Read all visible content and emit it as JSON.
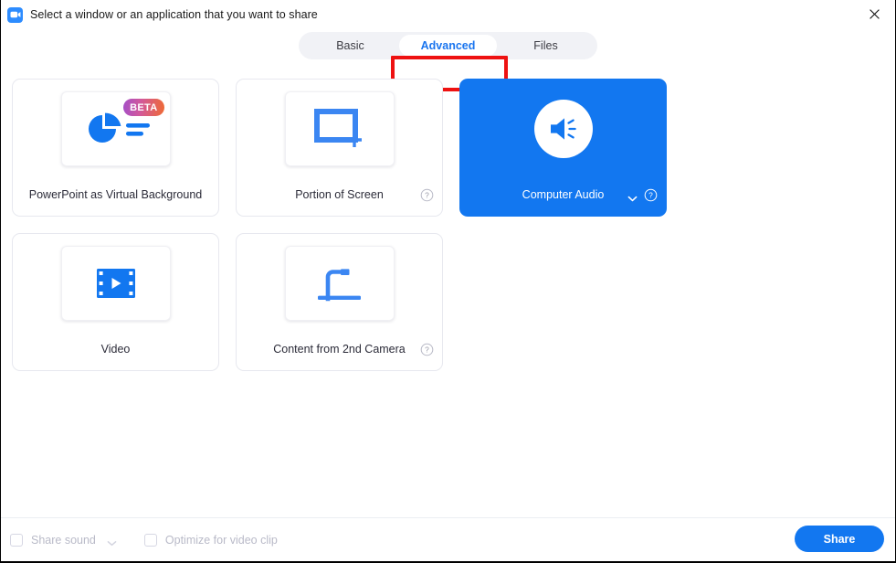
{
  "window": {
    "title": "Select a window or an application that you want to share",
    "app_icon": "zoom-video-icon",
    "close_icon": "close-icon"
  },
  "tabs": {
    "items": [
      {
        "label": "Basic",
        "active": false
      },
      {
        "label": "Advanced",
        "active": true
      },
      {
        "label": "Files",
        "active": false
      }
    ],
    "annotation_color": "#ee1111",
    "active_text_color": "#1a75ef"
  },
  "cards": [
    {
      "label": "PowerPoint as Virtual Background",
      "icon": "pie-chart-slide-icon",
      "badge": "BETA",
      "selected": false,
      "has_help": false,
      "has_chevron": false
    },
    {
      "label": "Portion of Screen",
      "icon": "screen-portion-icon",
      "badge": null,
      "selected": false,
      "has_help": true,
      "has_chevron": false
    },
    {
      "label": "Computer Audio",
      "icon": "speaker-icon",
      "badge": null,
      "selected": true,
      "has_help": true,
      "has_chevron": true
    },
    {
      "label": "Video",
      "icon": "film-strip-icon",
      "badge": null,
      "selected": false,
      "has_help": false,
      "has_chevron": false
    },
    {
      "label": "Content from 2nd Camera",
      "icon": "document-camera-icon",
      "badge": null,
      "selected": false,
      "has_help": true,
      "has_chevron": false
    }
  ],
  "footer": {
    "share_sound": {
      "label": "Share sound",
      "checked": false,
      "chevron_icon": "chevron-down-icon"
    },
    "optimize_video": {
      "label": "Optimize for video clip",
      "checked": false
    },
    "share_button": "Share"
  },
  "colors": {
    "accent_blue": "#1277f0",
    "tab_active_blue": "#1a75ef",
    "annotation_red": "#ee1111",
    "card_border": "#e7e8ef",
    "disabled_text": "#b9bac8"
  }
}
